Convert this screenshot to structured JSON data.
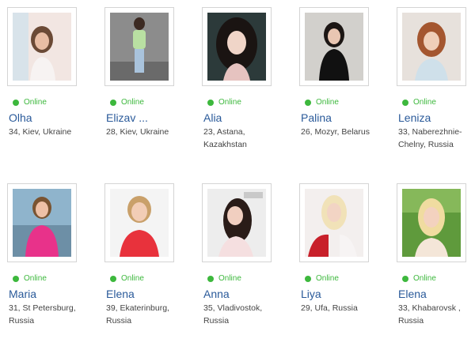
{
  "status_label": "Online",
  "accent_online": "#3db83d",
  "name_color": "#2a5a9a",
  "profiles": [
    {
      "name": "Olha",
      "location": "34, Kiev, Ukraine"
    },
    {
      "name": "Elizav ...",
      "location": "28, Kiev, Ukraine"
    },
    {
      "name": "Alia",
      "location": "23, Astana, Kazakhstan"
    },
    {
      "name": "Palina",
      "location": "26, Mozyr, Belarus"
    },
    {
      "name": "Leniza",
      "location": "33, Naberezhnie-Chelny, Russia"
    },
    {
      "name": "Maria",
      "location": "31, St Petersburg, Russia"
    },
    {
      "name": "Elena",
      "location": "39, Ekaterinburg, Russia"
    },
    {
      "name": "Anna",
      "location": "35, Vladivostok, Russia"
    },
    {
      "name": "Liya",
      "location": "29, Ufa, Russia"
    },
    {
      "name": "Elena",
      "location": "33, Khabarovsk , Russia"
    }
  ]
}
